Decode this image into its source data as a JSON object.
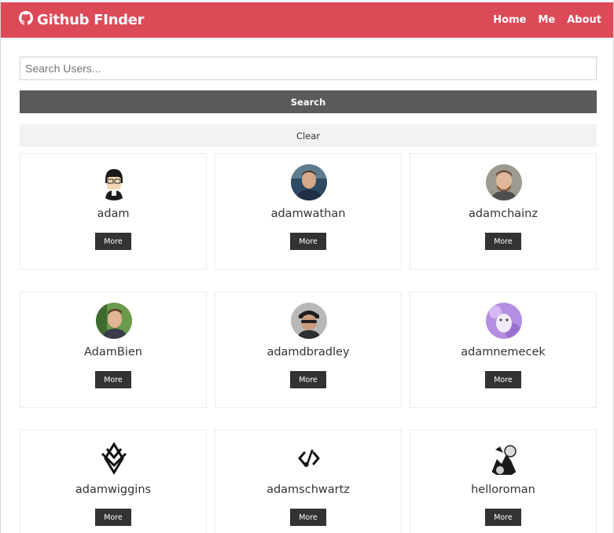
{
  "navbar": {
    "brand_icon": "github-icon",
    "brand_title": "Github FInder",
    "links": [
      "Home",
      "Me",
      "About"
    ],
    "accent_color": "#dc4a57"
  },
  "search": {
    "placeholder": "Search Users...",
    "value": "",
    "search_label": "Search",
    "clear_label": "Clear"
  },
  "users": [
    {
      "login": "adam",
      "more_label": "More",
      "avatar": "cartoon-avatar"
    },
    {
      "login": "adamwathan",
      "more_label": "More",
      "avatar": "photo-avatar"
    },
    {
      "login": "adamchainz",
      "more_label": "More",
      "avatar": "photo-avatar"
    },
    {
      "login": "AdamBien",
      "more_label": "More",
      "avatar": "photo-avatar"
    },
    {
      "login": "adamdbradley",
      "more_label": "More",
      "avatar": "photo-avatar"
    },
    {
      "login": "adamnemecek",
      "more_label": "More",
      "avatar": "purple-avatar"
    },
    {
      "login": "adamwiggins",
      "more_label": "More",
      "avatar": "logo-avatar"
    },
    {
      "login": "adamschwartz",
      "more_label": "More",
      "avatar": "code-avatar"
    },
    {
      "login": "helloroman",
      "more_label": "More",
      "avatar": "illustration-avatar"
    }
  ]
}
